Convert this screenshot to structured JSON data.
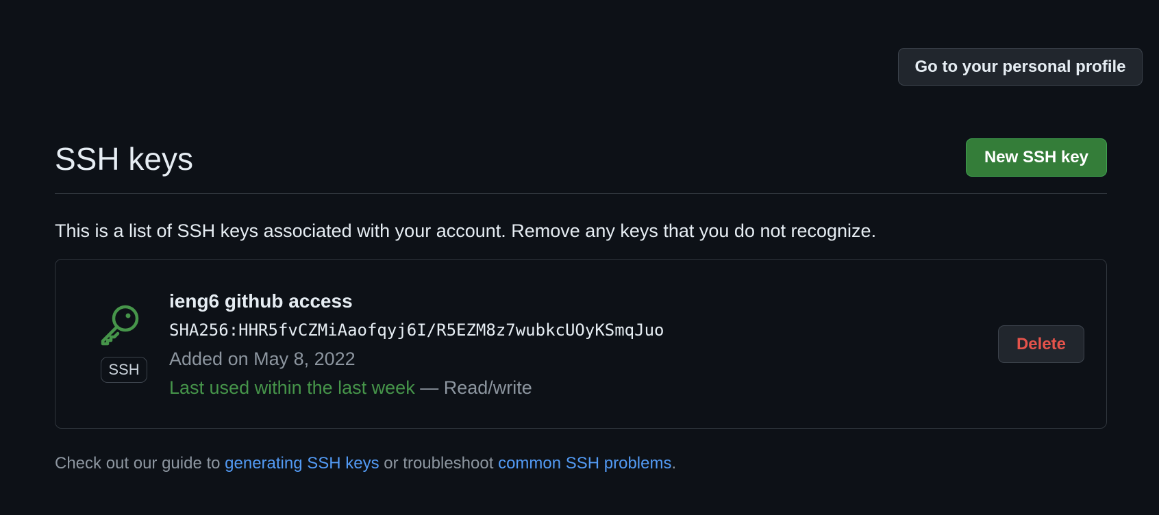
{
  "header": {
    "profile_button_label": "Go to your personal profile"
  },
  "ssh_keys": {
    "title": "SSH keys",
    "new_key_button_label": "New SSH key",
    "description": "This is a list of SSH keys associated with your account. Remove any keys that you do not recognize."
  },
  "key_entry": {
    "icon": "key-icon",
    "badge": "SSH",
    "title": "ieng6 github access",
    "fingerprint": "SHA256:HHR5fvCZMiAaofqyj6I/R5EZM8z7wubkcUOyKSmqJuo",
    "added": "Added on May 8, 2022",
    "last_used": "Last used within the last week",
    "access_separator": " — ",
    "access": "Read/write",
    "delete_label": "Delete"
  },
  "footer": {
    "prefix": "Check out our guide to ",
    "link_generating": "generating SSH keys",
    "middle": " or troubleshoot ",
    "link_problems": "common SSH problems",
    "suffix": "."
  },
  "colors": {
    "background": "#0d1117",
    "accent_green": "#347d39",
    "success_text": "#46954a",
    "danger_text": "#e5534b",
    "link": "#539bf5"
  }
}
